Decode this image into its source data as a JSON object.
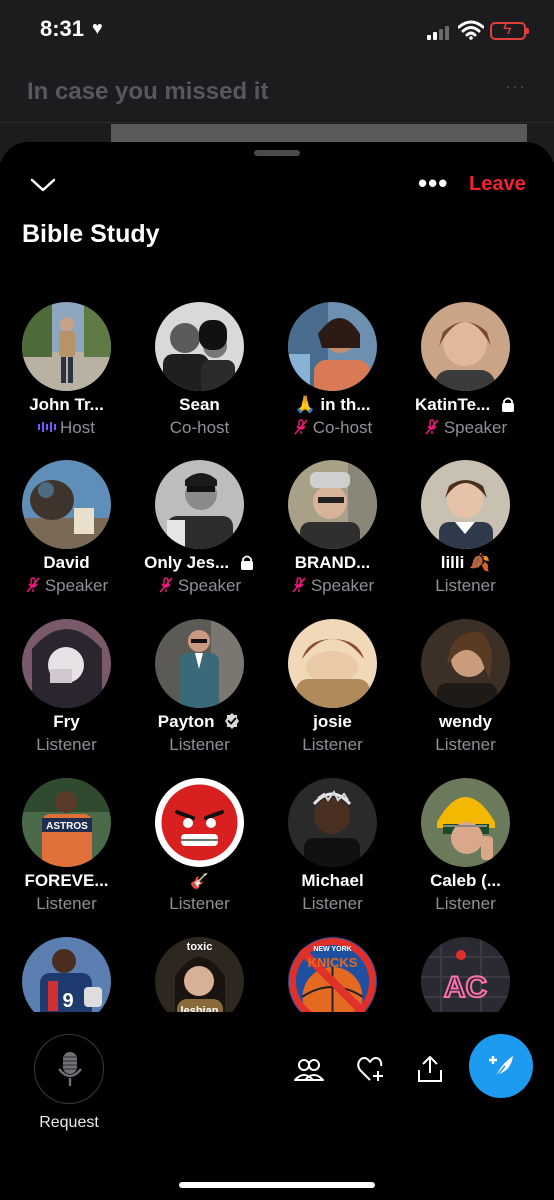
{
  "status_bar": {
    "time": "8:31",
    "heart": "♥"
  },
  "background": {
    "heading": "In case you missed it",
    "more": "···"
  },
  "header": {
    "leave_label": "Leave",
    "more": "•••",
    "title": "Bible Study"
  },
  "participants": [
    {
      "name": "John Tr...",
      "role": "Host",
      "role_icon": "soundwave-icon"
    },
    {
      "name": "Sean",
      "role": "Co-host"
    },
    {
      "name": "🙏 in th...",
      "role": "Co-host",
      "role_icon": "mic-off-icon"
    },
    {
      "name": "KatinTe...",
      "role": "Speaker",
      "role_icon": "mic-off-icon",
      "name_icon": "lock-icon"
    },
    {
      "name": "David",
      "role": "Speaker",
      "role_icon": "mic-off-icon"
    },
    {
      "name": "Only Jes...",
      "role": "Speaker",
      "role_icon": "mic-off-icon",
      "name_icon": "lock-icon"
    },
    {
      "name": "BRAND...",
      "role": "Speaker",
      "role_icon": "mic-off-icon"
    },
    {
      "name": "lilli 🍂",
      "role": "Listener"
    },
    {
      "name": "Fry",
      "role": "Listener"
    },
    {
      "name": "Payton",
      "role": "Listener",
      "name_icon": "verified-badge-icon"
    },
    {
      "name": "josie",
      "role": "Listener"
    },
    {
      "name": "wendy",
      "role": "Listener"
    },
    {
      "name": "FOREVE...",
      "role": "Listener"
    },
    {
      "name": "🎸",
      "role": "Listener"
    },
    {
      "name": "Michael",
      "role": "Listener"
    },
    {
      "name": "Caleb (...",
      "role": "Listener"
    },
    {
      "name": "",
      "role": "",
      "avatar_caption": "toxic"
    },
    {
      "name": "",
      "role": ""
    },
    {
      "name": "",
      "role": ""
    },
    {
      "name": "",
      "role": ""
    }
  ],
  "avatar_text": {
    "toxic_top": "toxic",
    "toxic_bottom": "lesbian",
    "knicks_text": "NEW YORK",
    "knicks_letters": "KNICKS",
    "ac_letters": "AC",
    "jersey_number": "9",
    "astros": "ASTROS"
  },
  "bottom": {
    "request_label": "Request"
  },
  "colors": {
    "leave": "#f4212e",
    "compose": "#1d9bf0",
    "muted_role": "#8b9197",
    "mute_icon": "#f91880",
    "host_wave": "#7856ff"
  }
}
